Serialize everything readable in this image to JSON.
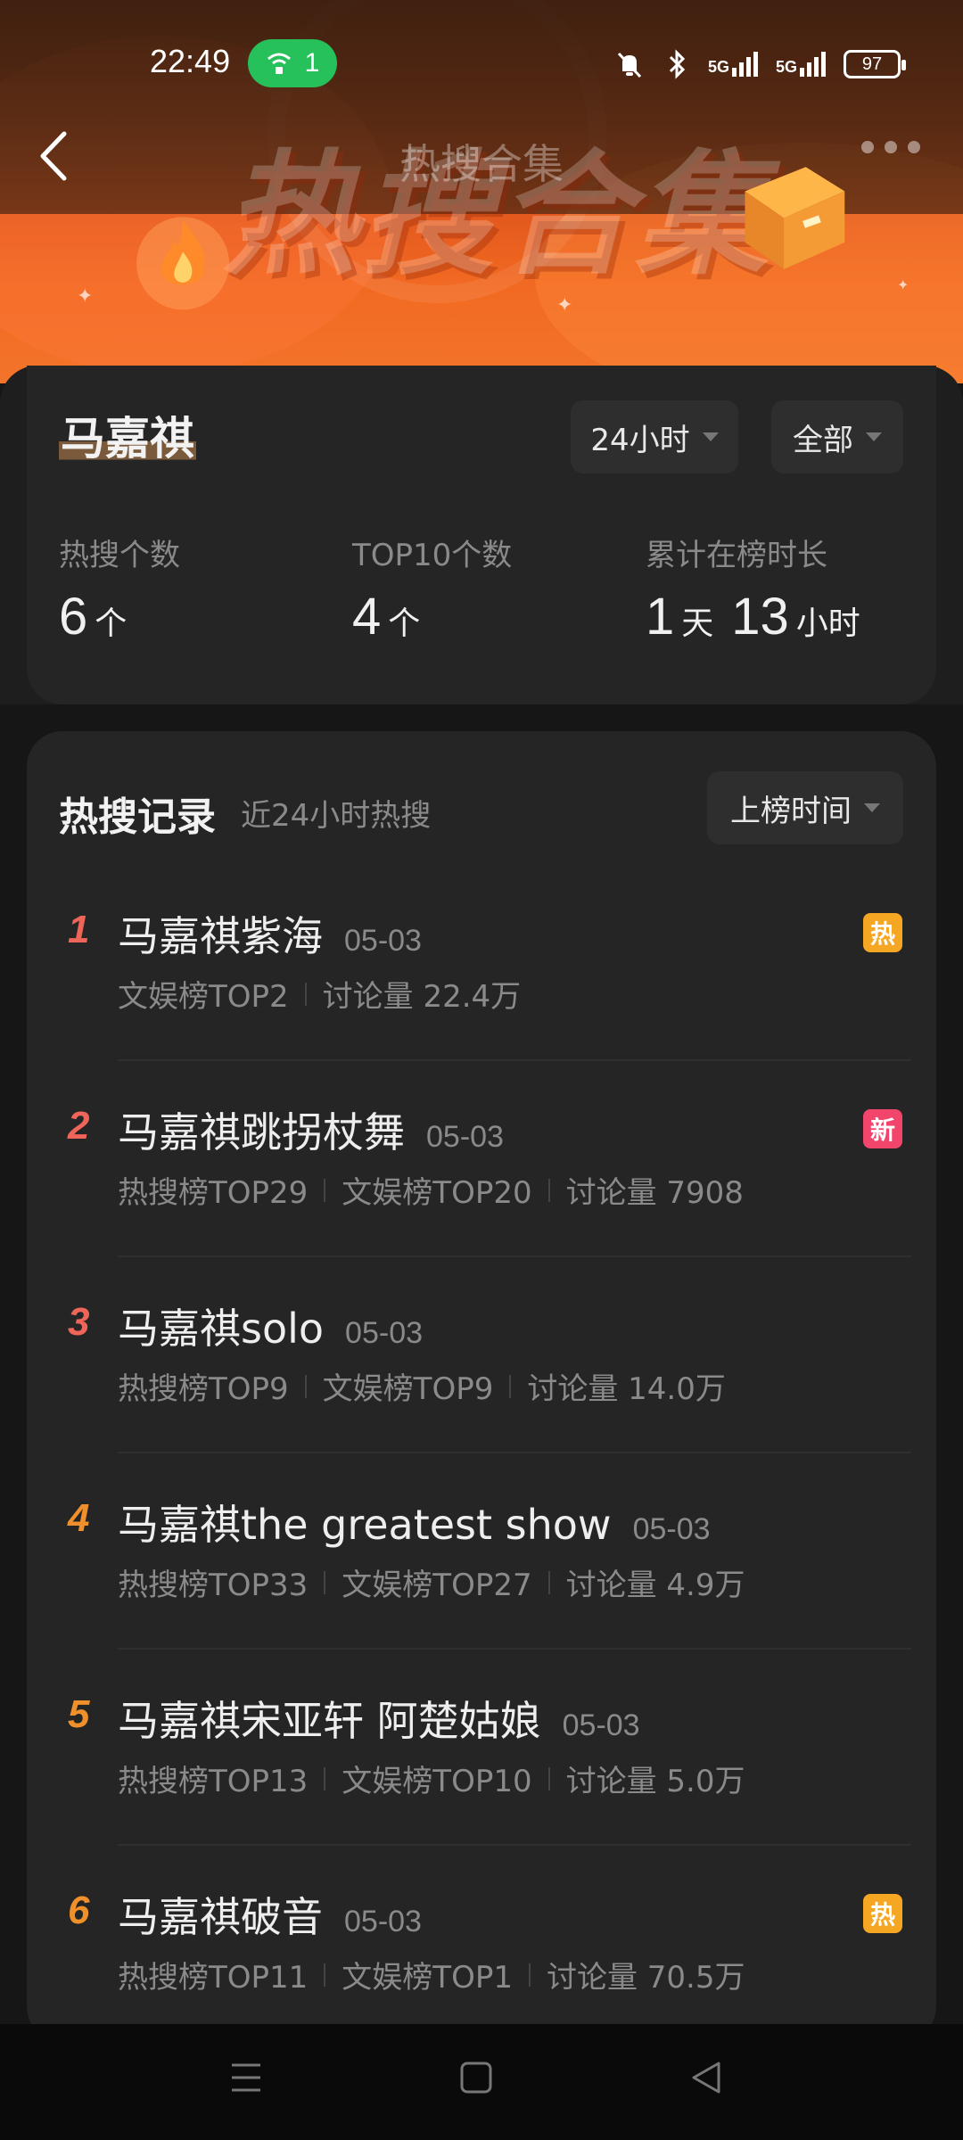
{
  "status_bar": {
    "time": "22:49",
    "wifi_count": "1",
    "battery": "97",
    "network_1": "5G",
    "network_2": "5G"
  },
  "nav": {
    "title": "热搜合集",
    "back_icon": "chevron-left-icon",
    "more_icon": "more-dots-icon"
  },
  "banner": {
    "title": "热搜合集"
  },
  "profile": {
    "name": "马嘉祺",
    "time_filter": "24小时",
    "scope_filter": "全部",
    "stats": [
      {
        "label": "热搜个数",
        "value": "6",
        "unit": "个"
      },
      {
        "label": "TOP10个数",
        "value": "4",
        "unit": "个"
      },
      {
        "label": "累计在榜时长",
        "value_days": "1",
        "unit_days": "天",
        "value_hours": "13",
        "unit_hours": "小时"
      }
    ]
  },
  "records": {
    "title": "热搜记录",
    "subtitle": "近24小时热搜",
    "sort_label": "上榜时间",
    "items": [
      {
        "rank": "1",
        "title": "马嘉祺紫海",
        "date": "05-03",
        "meta": [
          "文娱榜TOP2",
          "讨论量 22.4万"
        ],
        "badge": "热",
        "badge_color": "#f5a623",
        "rank_color": "#f0655a"
      },
      {
        "rank": "2",
        "title": "马嘉祺跳拐杖舞",
        "date": "05-03",
        "meta": [
          "热搜榜TOP29",
          "文娱榜TOP20",
          "讨论量 7908"
        ],
        "badge": "新",
        "badge_color": "#f2456b",
        "rank_color": "#f0655a"
      },
      {
        "rank": "3",
        "title": "马嘉祺solo",
        "date": "05-03",
        "meta": [
          "热搜榜TOP9",
          "文娱榜TOP9",
          "讨论量 14.0万"
        ],
        "badge": "",
        "badge_color": "",
        "rank_color": "#f0655a"
      },
      {
        "rank": "4",
        "title": "马嘉祺the greatest show",
        "date": "05-03",
        "meta": [
          "热搜榜TOP33",
          "文娱榜TOP27",
          "讨论量 4.9万"
        ],
        "badge": "",
        "badge_color": "",
        "rank_color": "#f0902a"
      },
      {
        "rank": "5",
        "title": "马嘉祺宋亚轩 阿楚姑娘",
        "date": "05-03",
        "meta": [
          "热搜榜TOP13",
          "文娱榜TOP10",
          "讨论量 5.0万"
        ],
        "badge": "",
        "badge_color": "",
        "rank_color": "#f0902a"
      },
      {
        "rank": "6",
        "title": "马嘉祺破音",
        "date": "05-03",
        "meta": [
          "热搜榜TOP11",
          "文娱榜TOP1",
          "讨论量 70.5万"
        ],
        "badge": "热",
        "badge_color": "#f5a623",
        "rank_color": "#f0902a"
      }
    ]
  },
  "bottom_nav": {
    "icons": [
      "menu-icon",
      "home-square-icon",
      "back-triangle-icon"
    ]
  }
}
